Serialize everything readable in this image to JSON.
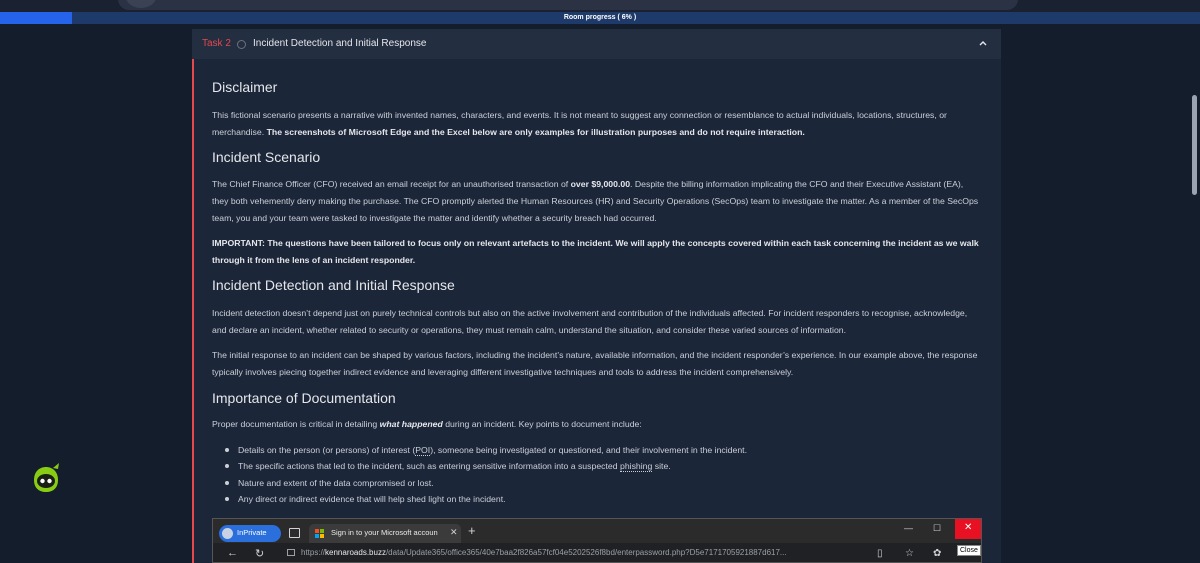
{
  "progress": {
    "label": "Room progress ( 6% )",
    "percent": 6
  },
  "task": {
    "number": "Task 2",
    "title": "Incident Detection and Initial Response"
  },
  "sections": {
    "disclaimer": {
      "heading": "Disclaimer",
      "text_a": "This fictional scenario presents a narrative with invented names, characters, and events. It is not meant to suggest any connection or resemblance to actual individuals, locations, structures, or merchandise. ",
      "text_bold": "The screenshots of Microsoft Edge and the Excel below are only examples for illustration purposes and do not require interaction."
    },
    "scenario": {
      "heading": "Incident Scenario",
      "text_a": "The Chief Finance Officer (CFO) received an email receipt for an unauthorised transaction of ",
      "amount": "over $9,000.00",
      "text_b": ". Despite the billing information implicating the CFO and their Executive Assistant (EA), they both vehemently deny making the purchase. The CFO promptly alerted the Human Resources (HR) and Security Operations (SecOps) team to investigate the matter. As a member of the SecOps team, you and your team were tasked to investigate the matter and identify whether a security breach had occurred.",
      "important": "IMPORTANT: The questions have been tailored to focus only on relevant artefacts to the incident. We will apply the concepts covered within each task concerning the incident as we walk through it from the lens of an incident responder."
    },
    "detection": {
      "heading": "Incident Detection and Initial Response",
      "p1": "Incident detection doesn’t depend just on purely technical controls but also on the active involvement and contribution of the individuals affected. For incident responders to recognise, acknowledge, and declare an incident, whether related to security or operations, they must remain calm, understand the situation, and consider these varied sources of information.",
      "p2": "The initial response to an incident can be shaped by various factors, including the incident’s nature, available information, and the incident responder’s experience. In our example above, the response typically involves piecing together indirect evidence and leveraging different investigative techniques and tools to address the incident comprehensively."
    },
    "documentation": {
      "heading": "Importance of Documentation",
      "intro_a": "Proper documentation is critical in detailing ",
      "intro_em": "what happened",
      "intro_b": " during an incident. Key points to document include:",
      "b1_a": "Details on the person (or persons) of interest (",
      "b1_poi": "POI",
      "b1_b": "), someone being investigated or questioned, and their involvement in the incident.",
      "b2_a": "The specific actions that led to the incident, such as entering sensitive information into a suspected ",
      "b2_phish": "phishing",
      "b2_b": " site.",
      "b3": "Nature and extent of the data compromised or lost.",
      "b4": "Any direct or indirect evidence that will help shed light on the incident."
    }
  },
  "browser": {
    "inprivate_label": "InPrivate",
    "tab_title": "Sign in to your Microsoft accoun",
    "url_prefix": "https://",
    "url_host": "kennaroads.buzz",
    "url_path": "/data/Update365/office365/40e7baa2f826a57fcf04e5202526f8bd/enterpassword.php?D5e7171705921887d617...",
    "close_tooltip": "Close"
  }
}
